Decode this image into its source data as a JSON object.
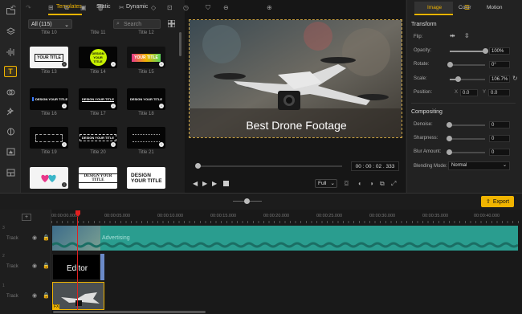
{
  "tabs": {
    "templates": "Templates",
    "static": "Static",
    "dynamic": "Dynamic"
  },
  "filter": {
    "value": "All (115)"
  },
  "search": {
    "placeholder": "Search"
  },
  "templates": [
    {
      "label": "Title 13",
      "text": "YOUR TITLE"
    },
    {
      "label": "Title 14",
      "text": "DESIGN YOUR TITLE"
    },
    {
      "label": "Title 15",
      "text": "YOUR TITLE"
    },
    {
      "label": "Title 16",
      "text": "DESIGN YOUR TITLE"
    },
    {
      "label": "Title 17",
      "text": "DESIGN YOUR TITLE"
    },
    {
      "label": "Title 18",
      "text": "DESIGN YOUR TITLE"
    },
    {
      "label": "Title 19",
      "text": ""
    },
    {
      "label": "Title 20",
      "text": "DESIGN YOUR TITLE"
    },
    {
      "label": "Title 21",
      "text": ""
    },
    {
      "label": "",
      "text": ""
    },
    {
      "label": "",
      "text": "DESIGN YOUR TITLE"
    },
    {
      "label": "",
      "text": "DESIGN YOUR TITLE"
    }
  ],
  "top_labels": [
    "Title 10",
    "Title 11",
    "Title 12"
  ],
  "preview": {
    "overlay_text": "Best Drone Footage",
    "timecode": "00 : 00 : 02 . 333",
    "zoom": "Full"
  },
  "right_tabs": {
    "image": "Image",
    "color": "Color",
    "motion": "Motion"
  },
  "transform": {
    "title": "Transform",
    "flip": "Flip:",
    "opacity_label": "Opacity:",
    "opacity_value": "100%",
    "opacity": 1.0,
    "rotate_label": "Rotate:",
    "rotate_value": "0°",
    "rotate": 0.0,
    "scale_label": "Scale:",
    "scale_value": "106.7%",
    "scale": 0.22,
    "position_label": "Position:",
    "x_label": "X",
    "x_value": "0.0",
    "y_label": "Y",
    "y_value": "0.0"
  },
  "compositing": {
    "title": "Compositing",
    "denoise_label": "Denoise:",
    "denoise_value": "0",
    "sharpness_label": "Sharpness:",
    "sharpness_value": "0",
    "blur_label": "Blur Amount:",
    "blur_value": "0",
    "blend_label": "Blending Mode:",
    "blend_value": "Normal"
  },
  "export": {
    "label": "Export"
  },
  "ruler": [
    "00:00:00.000",
    "00:00:05.000",
    "00:00:10.000",
    "00:00:15.000",
    "00:00:20.000",
    "00:00:25.000",
    "00:00:30.000",
    "00:00:35.000",
    "00:00:40.000"
  ],
  "tracks": [
    {
      "num": "3",
      "label": "Track"
    },
    {
      "num": "2",
      "label": "Track"
    },
    {
      "num": "1",
      "label": "Track"
    }
  ],
  "clips": {
    "audio": "Advertising",
    "text": "Editor"
  },
  "colors": {
    "accent": "#f0b400",
    "audio_clip": "#2a9d8f",
    "text_clip": "#000000"
  }
}
